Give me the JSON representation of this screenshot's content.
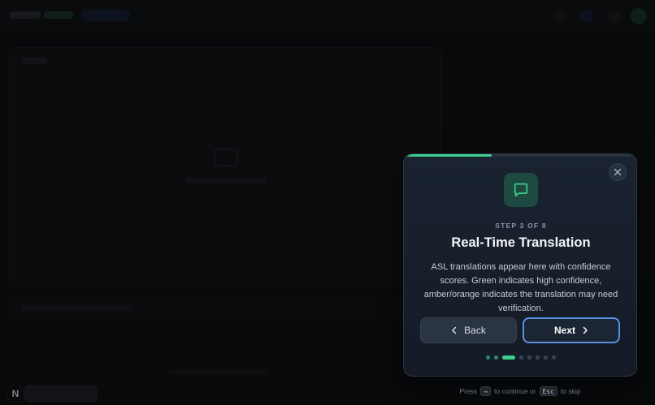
{
  "background": {
    "n_badge": "N"
  },
  "tour": {
    "progress_fraction": 0.375,
    "icon": "chat-bubble-icon",
    "step_label": "STEP 3 OF 8",
    "title": "Real-Time Translation",
    "description": "ASL translations appear here with confidence scores. Green indicates high confidence, amber/orange indicates the translation may need verification.",
    "back_label": "Back",
    "next_label": "Next",
    "current_step": 3,
    "total_steps": 8,
    "hint": {
      "press": "Press",
      "key_continue": "→",
      "continue_text": "to continue or",
      "key_skip": "Esc",
      "skip_text": "to skip"
    }
  },
  "colors": {
    "accent_green": "#3ecf8e",
    "next_border": "#5b8fe0",
    "modal_bg": "#1a2330"
  }
}
